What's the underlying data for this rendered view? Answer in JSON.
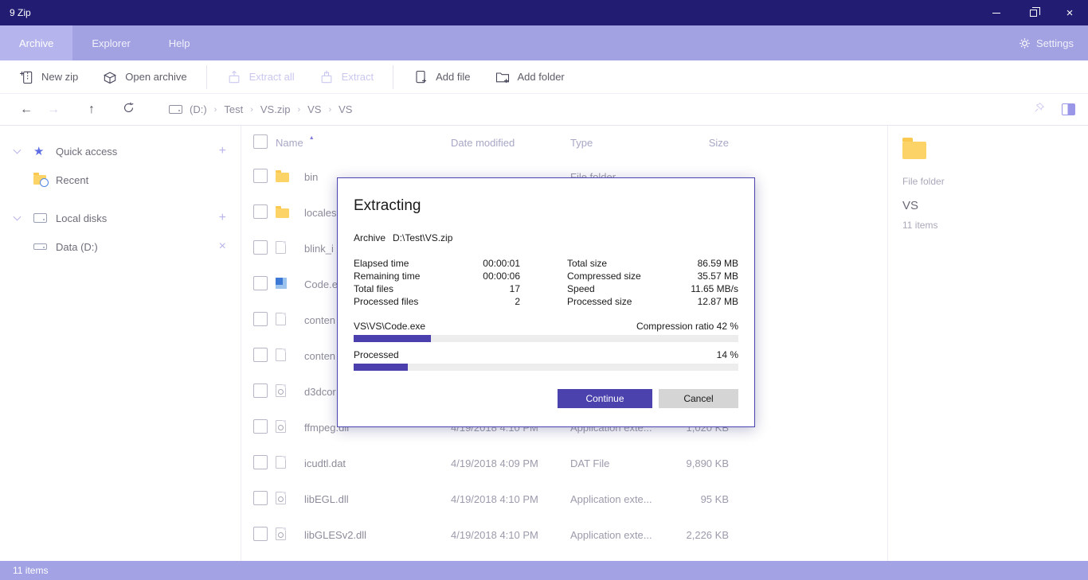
{
  "window": {
    "title": "9 Zip"
  },
  "menubar": {
    "tabs": [
      {
        "label": "Archive",
        "active": true
      },
      {
        "label": "Explorer",
        "active": false
      },
      {
        "label": "Help",
        "active": false
      }
    ],
    "settings_label": "Settings"
  },
  "toolbar": {
    "new_zip": "New zip",
    "open_archive": "Open archive",
    "extract_all": "Extract all",
    "extract": "Extract",
    "add_file": "Add file",
    "add_folder": "Add folder"
  },
  "breadcrumb": {
    "segments": [
      "(D:)",
      "Test",
      "VS.zip",
      "VS",
      "VS"
    ]
  },
  "sidebar": {
    "quick_access": "Quick access",
    "recent": "Recent",
    "local_disks": "Local disks",
    "data_drive": "Data (D:)"
  },
  "filelist": {
    "columns": {
      "name": "Name",
      "date": "Date modified",
      "type": "Type",
      "size": "Size"
    },
    "rows": [
      {
        "name": "bin",
        "icon": "folder",
        "date": "",
        "type": "File folder",
        "size": ""
      },
      {
        "name": "locales",
        "icon": "folder",
        "date": "",
        "type": "",
        "size": ""
      },
      {
        "name": "blink_i",
        "icon": "file",
        "date": "",
        "type": "",
        "size": ""
      },
      {
        "name": "Code.e",
        "icon": "exe",
        "date": "",
        "type": "",
        "size": ""
      },
      {
        "name": "conten",
        "icon": "file",
        "date": "",
        "type": "",
        "size": ""
      },
      {
        "name": "conten",
        "icon": "file",
        "date": "",
        "type": "",
        "size": ""
      },
      {
        "name": "d3dcor",
        "icon": "dll",
        "date": "",
        "type": "",
        "size": ""
      },
      {
        "name": "ffmpeg.dll",
        "icon": "dll",
        "date": "4/19/2018 4:10 PM",
        "type": "Application exte...",
        "size": "1,020 KB"
      },
      {
        "name": "icudtl.dat",
        "icon": "file",
        "date": "4/19/2018 4:09 PM",
        "type": "DAT File",
        "size": "9,890 KB"
      },
      {
        "name": "libEGL.dll",
        "icon": "dll",
        "date": "4/19/2018 4:10 PM",
        "type": "Application exte...",
        "size": "95 KB"
      },
      {
        "name": "libGLESv2.dll",
        "icon": "dll",
        "date": "4/19/2018 4:10 PM",
        "type": "Application exte...",
        "size": "2,226 KB"
      }
    ]
  },
  "preview": {
    "type": "File folder",
    "name": "VS",
    "items": "11 items"
  },
  "dialog": {
    "title": "Extracting",
    "archive_label": "Archive",
    "archive_path": "D:\\Test\\VS.zip",
    "stats_left": [
      {
        "label": "Elapsed time",
        "value": "00:00:01"
      },
      {
        "label": "Remaining time",
        "value": "00:00:06"
      },
      {
        "label": "Total files",
        "value": "17"
      },
      {
        "label": "Processed files",
        "value": "2"
      }
    ],
    "stats_right": [
      {
        "label": "Total size",
        "value": "86.59 MB"
      },
      {
        "label": "Compressed size",
        "value": "35.57 MB"
      },
      {
        "label": "Speed",
        "value": "11.65 MB/s"
      },
      {
        "label": "Processed size",
        "value": "12.87 MB"
      }
    ],
    "current_file": "VS\\VS\\Code.exe",
    "compression_ratio": "Compression ratio 42 %",
    "file_progress_percent": 20,
    "processed_label": "Processed",
    "processed_value": "14 %",
    "processed_percent": 14,
    "continue_label": "Continue",
    "cancel_label": "Cancel"
  },
  "statusbar": {
    "text": "11 items"
  }
}
